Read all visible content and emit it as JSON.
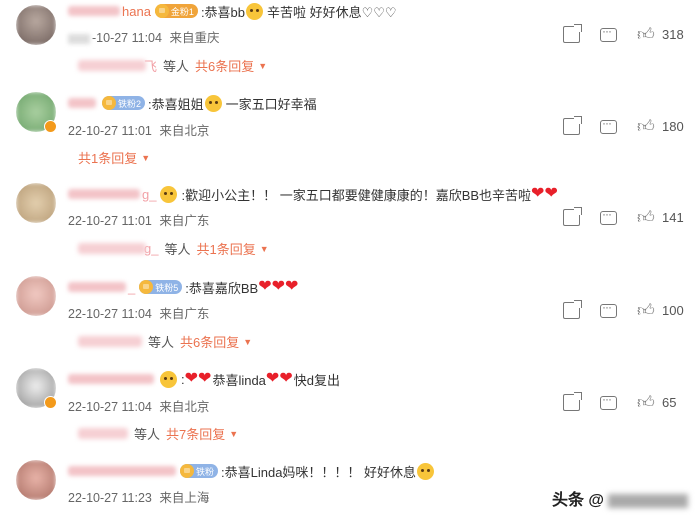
{
  "comments": [
    {
      "name_visible": "hana",
      "badge": "金粉1",
      "content": ":恭喜bb",
      "content_after": "辛苦啦 好好休息♡♡♡",
      "time": "-10-27 11:04",
      "location": "来自重庆",
      "likes": "318",
      "reply_users_suffix": "飞",
      "reply_middle": "等人",
      "reply_link": "共6条回复"
    },
    {
      "name_visible": "",
      "badge": "铁粉2",
      "content": ":恭喜姐姐",
      "content_after": "一家五口好幸福",
      "time": "22-10-27 11:01",
      "location": "来自北京",
      "likes": "180",
      "reply_link": "共1条回复"
    },
    {
      "name_visible": "g_",
      "badge": "",
      "content": ":歡迎小公主！！ 一家五口都要健健康康的！嘉欣BB也辛苦啦",
      "time": "22-10-27 11:01",
      "location": "来自广东",
      "likes": "141",
      "reply_users_suffix": "g_",
      "reply_middle": "等人",
      "reply_link": "共1条回复"
    },
    {
      "name_visible": "_",
      "badge": "铁粉5",
      "content": ":恭喜嘉欣BB",
      "time": "22-10-27 11:04",
      "location": "来自广东",
      "likes": "100",
      "reply_middle": "等人",
      "reply_link": "共6条回复"
    },
    {
      "name_visible": "",
      "badge": "",
      "content": ":",
      "content_mid": "恭喜linda",
      "content_after": "快d复出",
      "time": "22-10-27 11:04",
      "location": "来自北京",
      "likes": "65",
      "reply_middle": "等人",
      "reply_link": "共7条回复"
    },
    {
      "name_visible": "",
      "badge": "铁粉",
      "content": ":恭喜Linda妈咪！！！！ 好好休息",
      "time": "22-10-27 11:23",
      "location": "来自上海",
      "likes": ""
    }
  ],
  "icons": {
    "share": "share-icon",
    "reply": "comment-icon",
    "like": "thumbs-up-icon",
    "caret": "caret-down-icon"
  },
  "watermark": {
    "prefix": "头条 @"
  }
}
